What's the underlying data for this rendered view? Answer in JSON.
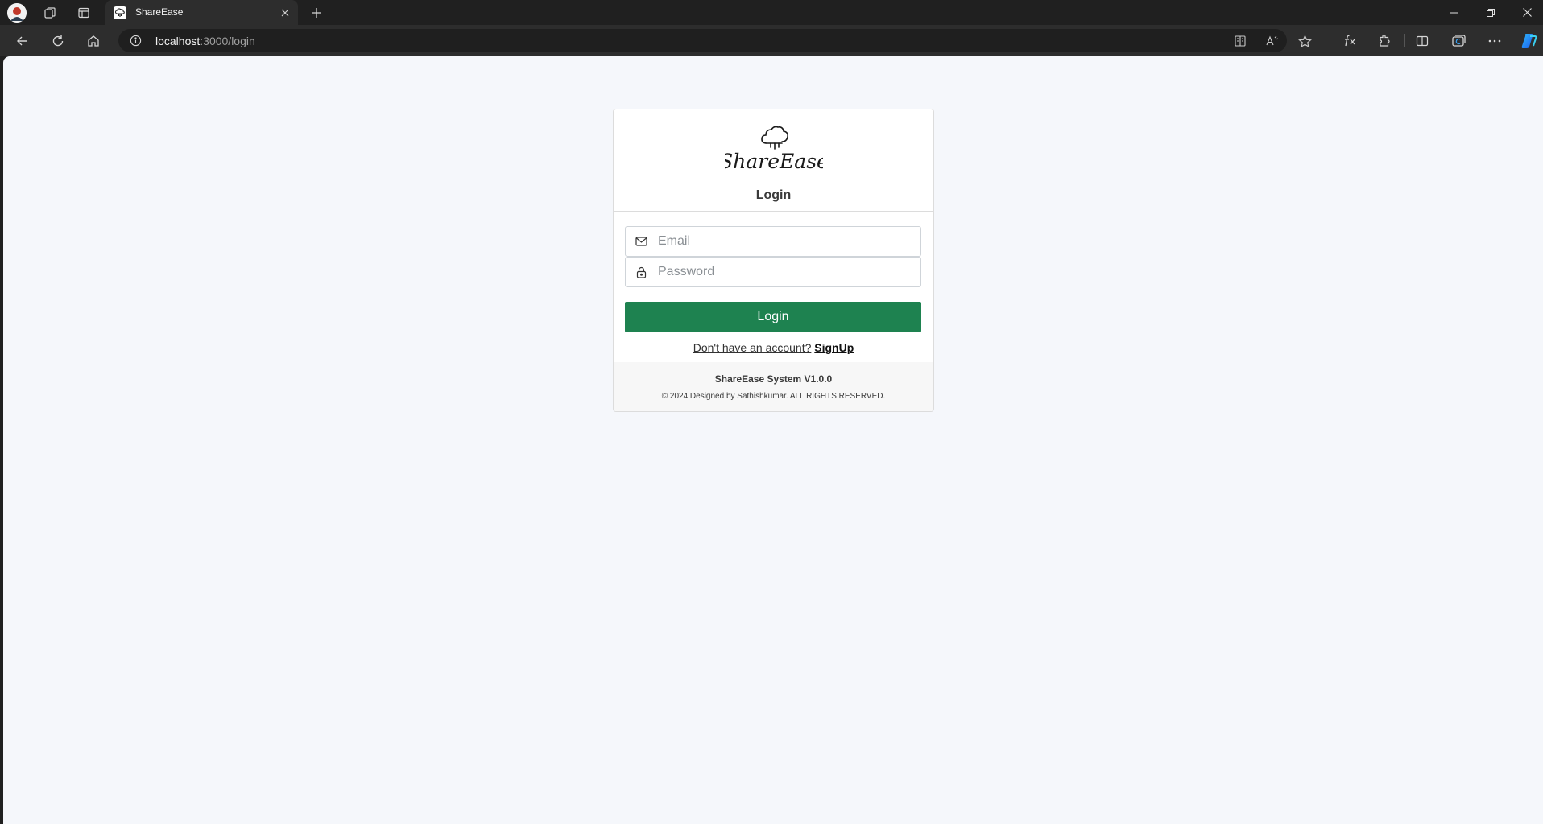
{
  "browser": {
    "tab": {
      "title": "ShareEase"
    },
    "address": {
      "host": "localhost",
      "path": ":3000/login"
    }
  },
  "page": {
    "brand": "ShareEase",
    "title": "Login",
    "email": {
      "placeholder": "Email",
      "value": ""
    },
    "password": {
      "placeholder": "Password",
      "value": ""
    },
    "login_button": "Login",
    "signup_prompt": "Don't have an account?",
    "signup_link": "SignUp",
    "footer": {
      "version": "ShareEase System V1.0.0",
      "copyright": "© 2024 Designed by Sathishkumar. ALL RIGHTS RESERVED."
    },
    "colors": {
      "primary": "#1e8250",
      "background": "#f5f7fb"
    }
  },
  "icons": [
    "profile-avatar",
    "workspaces-icon",
    "vertical-tabs-icon",
    "close-icon",
    "plus-icon",
    "minimize-icon",
    "restore-icon",
    "back-icon",
    "refresh-icon",
    "home-icon",
    "info-icon",
    "immersive-reader-icon",
    "read-aloud-icon",
    "star-icon",
    "formula-icon",
    "extensions-icon",
    "split-screen-icon",
    "collections-icon",
    "more-icon",
    "copilot-icon",
    "mail-icon",
    "lock-icon"
  ]
}
